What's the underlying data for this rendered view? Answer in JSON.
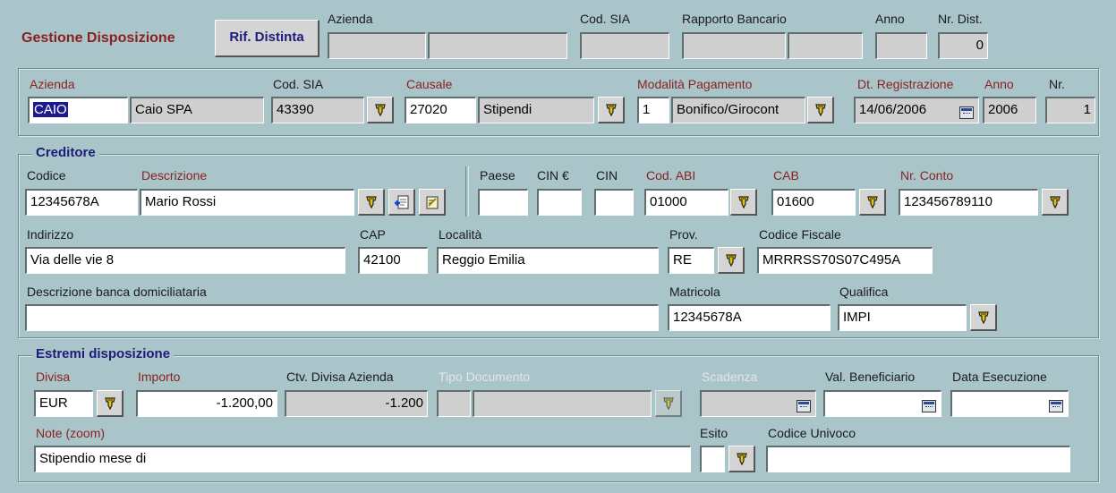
{
  "header": {
    "title": "Gestione Disposizione",
    "rif_button": "Rif. Distinta",
    "labels": {
      "azienda": "Azienda",
      "cod_sia": "Cod. SIA",
      "rapporto": "Rapporto Bancario",
      "anno": "Anno",
      "nr_dist": "Nr. Dist."
    },
    "values": {
      "nr_dist": "0"
    }
  },
  "top": {
    "labels": {
      "azienda": "Azienda",
      "cod_sia": "Cod. SIA",
      "causale": "Causale",
      "modalita": "Modalità Pagamento",
      "dt_reg": "Dt. Registrazione",
      "anno": "Anno",
      "nr": "Nr."
    },
    "values": {
      "azienda_code": "CAIO",
      "azienda_name": "Caio SPA",
      "cod_sia": "43390",
      "causale_code": "27020",
      "causale_desc": "Stipendi",
      "modalita_code": "1",
      "modalita_desc": "Bonifico/Girocont",
      "dt_reg": "14/06/2006",
      "anno": "2006",
      "nr": "1"
    }
  },
  "creditore": {
    "title": "Creditore",
    "labels": {
      "codice": "Codice",
      "descrizione": "Descrizione",
      "paese": "Paese",
      "cin_eur": "CIN €",
      "cin": "CIN",
      "cod_abi": "Cod. ABI",
      "cab": "CAB",
      "nr_conto": "Nr. Conto",
      "indirizzo": "Indirizzo",
      "cap": "CAP",
      "localita": "Località",
      "prov": "Prov.",
      "codice_fiscale": "Codice Fiscale",
      "banca": "Descrizione banca domiciliataria",
      "matricola": "Matricola",
      "qualifica": "Qualifica"
    },
    "values": {
      "codice": "12345678A",
      "descrizione": "Mario Rossi",
      "cod_abi": "01000",
      "cab": "01600",
      "nr_conto": "123456789110",
      "indirizzo": "Via delle vie 8",
      "cap": "42100",
      "localita": "Reggio Emilia",
      "prov": "RE",
      "codice_fiscale": "MRRRSS70S07C495A",
      "matricola": "12345678A",
      "qualifica": "IMPI"
    }
  },
  "estremi": {
    "title": "Estremi disposizione",
    "labels": {
      "divisa": "Divisa",
      "importo": "Importo",
      "ctv": "Ctv. Divisa Azienda",
      "tipo_doc": "Tipo Documento",
      "scadenza": "Scadenza",
      "val_benef": "Val. Beneficiario",
      "data_esec": "Data Esecuzione",
      "note": "Note (zoom)",
      "esito": "Esito",
      "codice_univoco": "Codice Univoco"
    },
    "values": {
      "divisa": "EUR",
      "importo": "-1.200,00",
      "ctv": "-1.200",
      "note": "Stipendio mese di"
    }
  },
  "colors": {
    "background": "#a9c5c9",
    "title_red": "#8c1f1f",
    "group_title_blue": "#1c1c7a",
    "readonly_field": "#cfcfcf"
  }
}
